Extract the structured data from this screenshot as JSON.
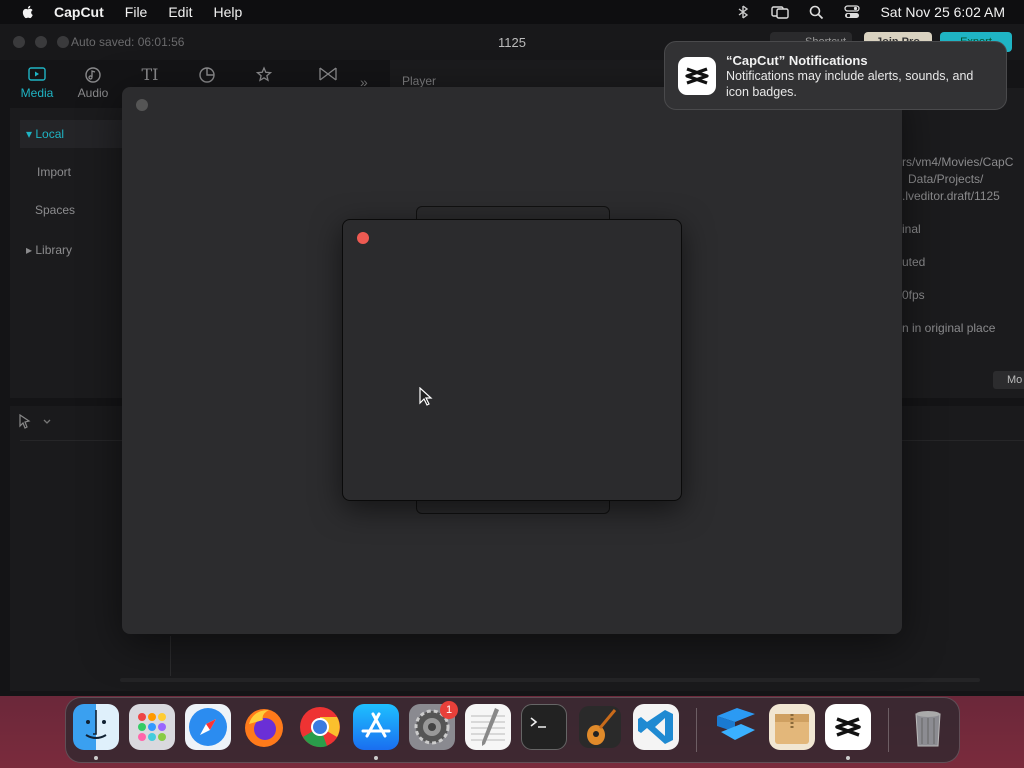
{
  "menubar": {
    "app_name": "CapCut",
    "menus": [
      "File",
      "Edit",
      "Help"
    ],
    "clock": "Sat Nov 25  6:02 AM"
  },
  "window": {
    "autosave": "Auto saved: 06:01:56",
    "project_name": "1125",
    "shortcut_label": "Shortcut",
    "join_pro_label": "Join Pro",
    "export_label": "Export"
  },
  "toolbar": {
    "items": [
      {
        "label": "Media",
        "icon": "media-icon"
      },
      {
        "label": "Audio",
        "icon": "audio-icon"
      },
      {
        "label": "",
        "icon": "text-icon",
        "glyph": "TI"
      },
      {
        "label": "",
        "icon": "stickers-icon"
      },
      {
        "label": "",
        "icon": "effects-icon"
      },
      {
        "label": "",
        "icon": "transitions-icon"
      }
    ],
    "more": "»"
  },
  "left_panel": {
    "local": "Local",
    "import": "Import",
    "spaces": "Spaces",
    "library": "Library"
  },
  "player": {
    "label": "Player"
  },
  "details": {
    "path_line1": "rs/vm4/Movies/CapC",
    "path_line2": "Data/Projects/",
    "path_line3": ".lveditor.draft/1125",
    "row1": "inal",
    "row2": "uted",
    "row3": "0fps",
    "row4": "n in original place",
    "modify": "Mo"
  },
  "notification": {
    "title": "“CapCut” Notifications",
    "body": "Notifications may include alerts, sounds, and icon badges."
  },
  "dock": {
    "badge": "1",
    "apps": [
      "Finder",
      "Launchpad",
      "Safari",
      "Firefox",
      "Chrome",
      "App Store",
      "System Settings",
      "TextEdit",
      "Terminal",
      "GarageBand",
      "VS Code",
      "Paper",
      "Archive Utility",
      "CapCut",
      "Trash"
    ]
  }
}
